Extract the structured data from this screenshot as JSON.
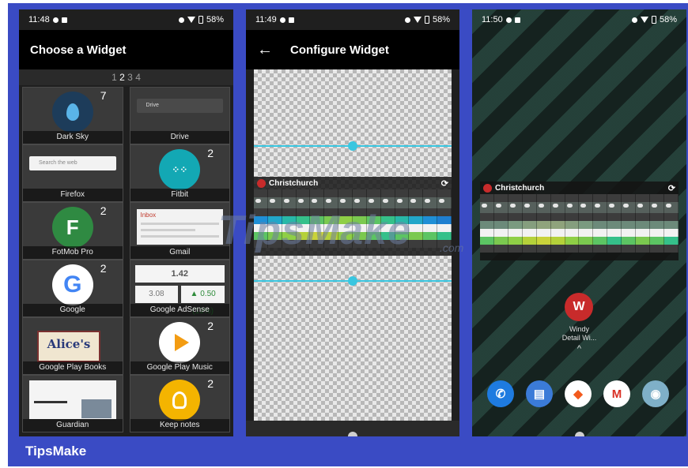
{
  "footer": {
    "brand": "TipsMake"
  },
  "watermark": {
    "text": "TipsMake",
    "suffix": ".com"
  },
  "phone1": {
    "status": {
      "time": "11:48",
      "battery": "58%"
    },
    "title": "Choose a Widget",
    "pager": {
      "p1": "1",
      "p2": "2",
      "p3": "3",
      "p4": "4"
    },
    "widgets": [
      {
        "label": "Dark Sky",
        "badge": "7"
      },
      {
        "label": "Drive",
        "badge": "",
        "bar_text": "Drive"
      },
      {
        "label": "Firefox",
        "badge": "",
        "bar_text": "Search the web"
      },
      {
        "label": "Fitbit",
        "badge": "2"
      },
      {
        "label": "FotMob Pro",
        "badge": "2"
      },
      {
        "label": "Gmail",
        "badge": "",
        "inbox": "Inbox"
      },
      {
        "label": "Google",
        "badge": "2"
      },
      {
        "label": "Google AdSense",
        "badge": "",
        "top": "1.42",
        "left": "3.08",
        "right": "▲ 0.50 (19%)"
      },
      {
        "label": "Google Play Books",
        "badge": "",
        "cover": "Alice's"
      },
      {
        "label": "Google Play Music",
        "badge": "2"
      },
      {
        "label": "Guardian",
        "badge": ""
      },
      {
        "label": "Keep notes",
        "badge": "2"
      }
    ]
  },
  "phone2": {
    "status": {
      "time": "11:49",
      "battery": "58%"
    },
    "title": "Configure Widget",
    "back": "←",
    "widget": {
      "location": "Christchurch",
      "refresh": "⟳"
    }
  },
  "phone3": {
    "status": {
      "time": "11:50",
      "battery": "58%"
    },
    "widget": {
      "location": "Christchurch",
      "refresh": "⟳"
    },
    "app": {
      "name": "Windy",
      "sub": "Detail Wi...",
      "chevron": "^"
    },
    "colors": {
      "windy": "#c82b2b",
      "phone": "#1e7be0",
      "messages": "#3b7bd8",
      "brave": "#ffffff",
      "gmail": "#ffffff",
      "camera": "#7fb0c8"
    }
  }
}
